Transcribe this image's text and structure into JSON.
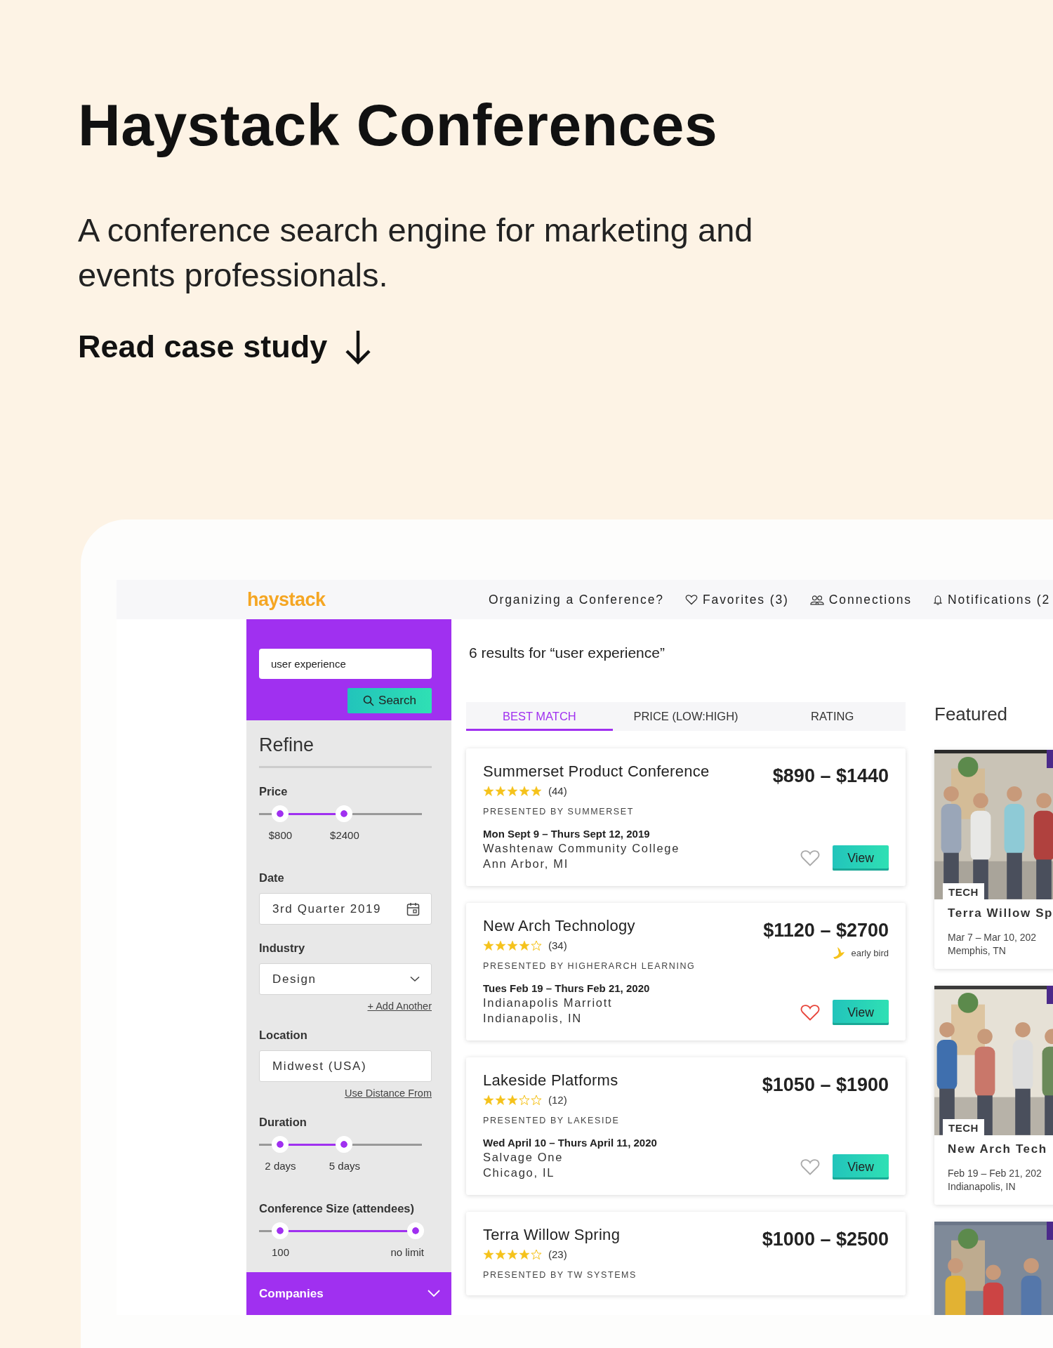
{
  "hero": {
    "title": "Haystack Conferences",
    "subtitle": "A conference search engine for marketing and events professionals.",
    "link": "Read case study"
  },
  "app": {
    "logo": "haystack",
    "nav": [
      {
        "label": "Organizing a Conference?"
      },
      {
        "label": "Favorites (3)"
      },
      {
        "label": "Connections"
      },
      {
        "label": "Notifications (2"
      }
    ],
    "search": {
      "value": "user experience",
      "button": "Search"
    },
    "refine": {
      "title": "Refine",
      "filters": [
        {
          "kind": "range",
          "label": "Price",
          "thumbs": [
            {
              "level": 0.13,
              "value": "$800"
            },
            {
              "level": 0.52,
              "value": "$2400"
            }
          ]
        },
        {
          "kind": "date",
          "label": "Date",
          "value": "3rd Quarter 2019"
        },
        {
          "kind": "select",
          "label": "Industry",
          "value": "Design",
          "link": "+ Add Another"
        },
        {
          "kind": "text",
          "label": "Location",
          "value": "Midwest (USA)",
          "link": "Use Distance From"
        },
        {
          "kind": "range",
          "label": "Duration",
          "thumbs": [
            {
              "level": 0.13,
              "value": "2 days"
            },
            {
              "level": 0.52,
              "value": "5 days"
            }
          ]
        },
        {
          "kind": "range",
          "label": "Conference Size (attendees)",
          "thumbs": [
            {
              "level": 0.13,
              "value": "100"
            },
            {
              "level": 0.96,
              "value": "no limit"
            }
          ]
        }
      ],
      "section": {
        "label": "Companies",
        "expanded": false
      }
    },
    "results_heading": "6 results for “user experience”",
    "tabs": [
      {
        "label": "BEST MATCH",
        "selected": true
      },
      {
        "label": "PRICE (LOW:HIGH)",
        "selected": false
      },
      {
        "label": "RATING",
        "selected": false
      }
    ],
    "results": [
      {
        "title": "Summerset Product Conference",
        "stars": 5,
        "reviews": "(44)",
        "presenter": "PRESENTED BY SUMMERSET",
        "dates": "Mon Sept 9 – Thurs Sept 12, 2019",
        "venue": "Washtenaw Community College",
        "city": "Ann Arbor, MI",
        "price": "$890 – $1440",
        "favorite": false,
        "button": "View"
      },
      {
        "title": "New Arch Technology",
        "stars": 4,
        "reviews": "(34)",
        "presenter": "PRESENTED BY HIGHERARCH LEARNING",
        "dates": "Tues Feb 19 – Thurs Feb 21, 2020",
        "venue": "Indianapolis Marriott",
        "city": "Indianapolis, IN",
        "price": "$1120 – $2700",
        "badge": "early bird",
        "favorite": true,
        "button": "View"
      },
      {
        "title": "Lakeside Platforms",
        "stars": 3,
        "reviews": "(12)",
        "presenter": "PRESENTED BY LAKESIDE",
        "dates": "Wed April 10 – Thurs April 11, 2020",
        "venue": "Salvage One",
        "city": "Chicago, IL",
        "price": "$1050 – $1900",
        "favorite": false,
        "button": "View"
      },
      {
        "title": "Terra Willow Spring",
        "stars": 4,
        "reviews": "(23)",
        "presenter": "PRESENTED BY TW SYSTEMS",
        "price": "$1000 – $2500"
      }
    ],
    "featured": {
      "title": "Featured",
      "items": [
        {
          "kind": "picture",
          "tag": "TECH",
          "title": "Terra Willow Sp",
          "dates": "Mar 7 – Mar 10, 202",
          "city": "Memphis, TN"
        },
        {
          "kind": "picture",
          "tag": "TECH",
          "title": "New Arch Tech",
          "dates": "Feb 19 – Feb 21, 202",
          "city": "Indianapolis, IN"
        },
        {
          "kind": "picture"
        }
      ]
    }
  }
}
